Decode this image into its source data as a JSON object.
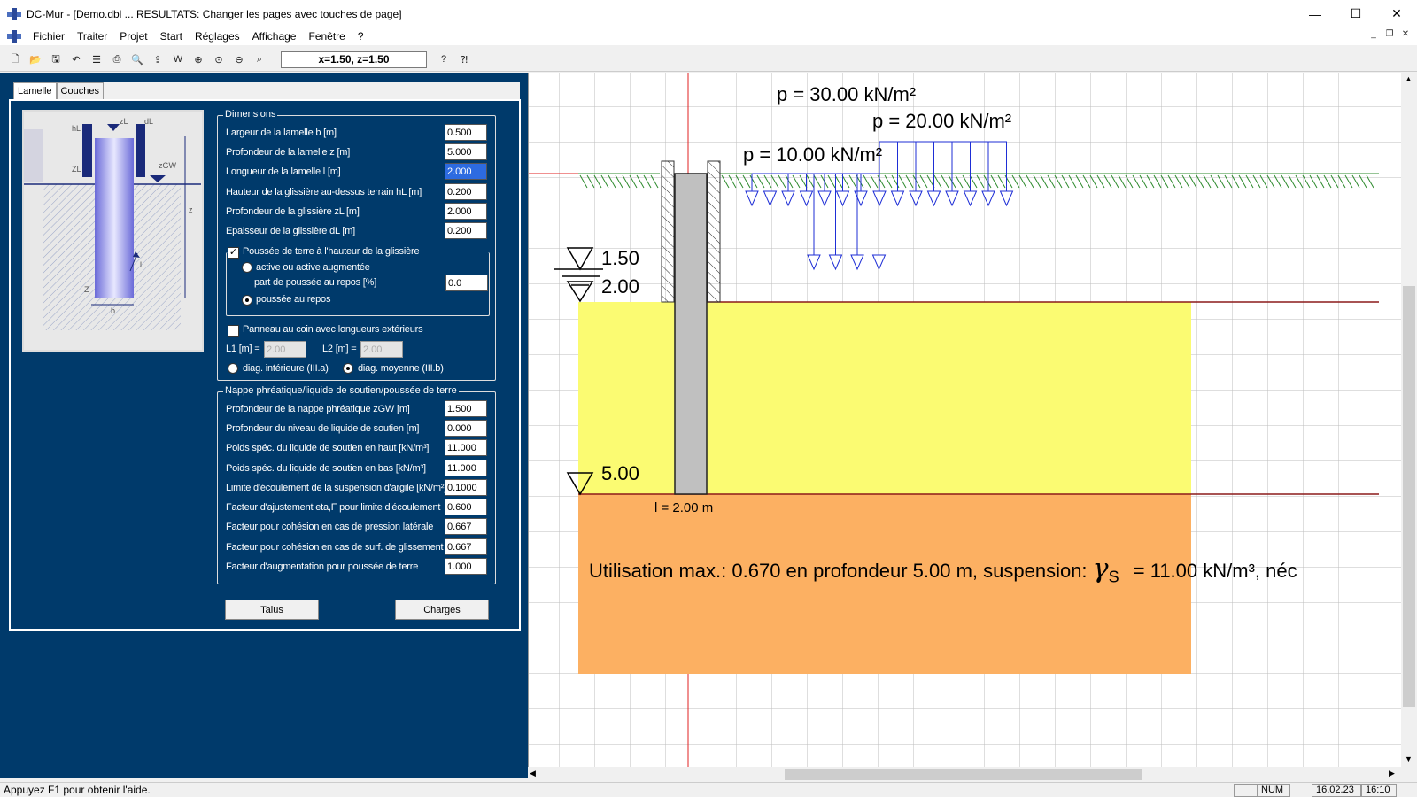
{
  "window": {
    "title": "DC-Mur - [Demo.dbl ... RESULTATS: Changer les pages avec touches de page]",
    "controls": [
      "—",
      "☐",
      "✕"
    ]
  },
  "menu": [
    "Fichier",
    "Traiter",
    "Projet",
    "Start",
    "Réglages",
    "Affichage",
    "Fenêtre",
    "?"
  ],
  "toolbar": {
    "icons": [
      "new-file-icon",
      "open-file-icon",
      "save-icon",
      "undo-icon",
      "list-icon",
      "print-icon",
      "print-preview-icon",
      "export-icon",
      "word-icon",
      "zoom-in-icon",
      "zoom-fit-icon",
      "zoom-out-icon",
      "zoom-window-icon",
      "help-icon",
      "context-help-icon"
    ],
    "coord": "x=1.50, z=1.50"
  },
  "tabs": [
    "Lamelle",
    "Couches"
  ],
  "sketch": {
    "labels": [
      "hL",
      "zL",
      "dL",
      "ZL",
      "zGW",
      "z",
      "l",
      "Z",
      "b"
    ]
  },
  "dimensions": {
    "title": "Dimensions",
    "rows": [
      {
        "label": "Largeur de la lamelle b [m]",
        "value": "0.500"
      },
      {
        "label": "Profondeur de la lamelle z [m]",
        "value": "5.000"
      },
      {
        "label": "Longueur de la lamelle l [m]",
        "value": "2.000"
      },
      {
        "label": "Hauteur de la glissière au-dessus terrain hL [m]",
        "value": "0.200"
      },
      {
        "label": "Profondeur de la glissière zL [m]",
        "value": "2.000"
      },
      {
        "label": "Epaisseur de la glissière dL [m]",
        "value": "0.200"
      }
    ],
    "pressure_check": "Poussée de terre à l'hauteur de la glissière",
    "radio_active": "active ou active augmentée",
    "part_label": "part de poussée au repos [%]",
    "part_value": "0.0",
    "radio_rest": "poussée au repos",
    "panel_check": "Panneau au coin avec longueurs extérieurs",
    "l1_label": "L1 [m] =",
    "l1_value": "2.00",
    "l2_label": "L2 [m] =",
    "l2_value": "2.00",
    "diag_inner": "diag. intérieure (III.a)",
    "diag_mid": "diag. moyenne (III.b)"
  },
  "groundwater": {
    "title": "Nappe phréatique/liquide de soutien/poussée de terre",
    "rows": [
      {
        "label": "Profondeur de la nappe phréatique zGW [m]",
        "value": "1.500"
      },
      {
        "label": "Profondeur du niveau de liquide de soutien [m]",
        "value": "0.000"
      },
      {
        "label": "Poids spéc. du liquide de soutien en haut [kN/m³]",
        "value": "11.000"
      },
      {
        "label": "Poids spéc. du liquide de soutien en bas [kN/m³]",
        "value": "11.000"
      },
      {
        "label": "Limite d'écoulement de la suspension d'argile [kN/m²]",
        "value": "0.1000"
      },
      {
        "label": "Facteur d'ajustement eta,F pour limite d'écoulement",
        "value": "0.600"
      },
      {
        "label": "Facteur pour cohésion en cas de pression latérale",
        "value": "0.667"
      },
      {
        "label": "Facteur pour cohésion en cas de surf. de glissement",
        "value": "0.667"
      },
      {
        "label": "Facteur d'augmentation pour poussée de terre",
        "value": "1.000"
      }
    ]
  },
  "buttons": {
    "talus": "Talus",
    "charges": "Charges"
  },
  "drawing": {
    "load1": "p = 30.00 kN/m²",
    "load2": "p = 20.00 kN/m²",
    "load3": "p = 10.00 kN/m²",
    "level1": "1.50",
    "level2": "2.00",
    "level3": "5.00",
    "length": "l = 2.00 m",
    "result_prefix": "Utilisation max.: 0.670 en profondeur 5.00 m, suspension:",
    "gamma": "γ",
    "gamma_sub": "S",
    "result_suffix": "= 11.00 kN/m³, néc",
    "colors": {
      "soil_top": "#fbfb72",
      "soil_bottom": "#fcb062",
      "grass": "#2e8b2e",
      "load": "#1e2ed6",
      "wall": "#c0c0c0"
    }
  },
  "status": {
    "help": "Appuyez F1 pour obtenir l'aide.",
    "num": "NUM",
    "date": "16.02.23",
    "time": "16:10"
  }
}
